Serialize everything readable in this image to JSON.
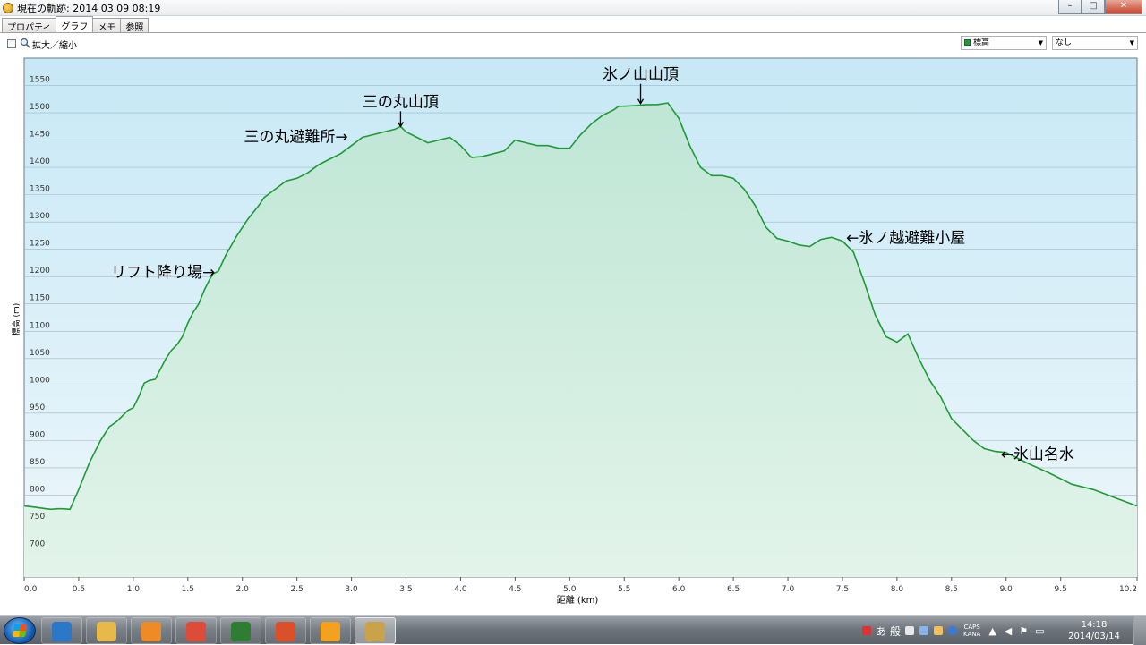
{
  "window": {
    "title": "現在の軌跡: 2014 03 09 08:19",
    "buttons": {
      "minimize": "–",
      "maximize": "□",
      "close": "✕"
    }
  },
  "tabs": [
    {
      "label": "プロパティ",
      "active": false
    },
    {
      "label": "グラフ",
      "active": true
    },
    {
      "label": "メモ",
      "active": false
    },
    {
      "label": "参照",
      "active": false
    }
  ],
  "toolbar": {
    "zoom_label": "拡大／縮小",
    "zoom_checked": false,
    "series_select": "標高",
    "compare_select": "なし"
  },
  "chart_data": {
    "type": "area",
    "xlabel": "距離 (km)",
    "ylabel": "標高 (m)",
    "xlim": [
      0.0,
      10.2
    ],
    "ylim": [
      650,
      1600
    ],
    "xticks": [
      "0.0",
      "0.5",
      "1.0",
      "1.5",
      "2.0",
      "2.5",
      "3.0",
      "3.5",
      "4.0",
      "4.5",
      "5.0",
      "5.5",
      "6.0",
      "6.5",
      "7.0",
      "7.5",
      "8.0",
      "8.5",
      "9.0",
      "9.5",
      "10.2"
    ],
    "yticks": [
      "1550",
      "1500",
      "1450",
      "1400",
      "1350",
      "1300",
      "1250",
      "1200",
      "1150",
      "1100",
      "1050",
      "1000",
      "950",
      "900",
      "850",
      "800",
      "750",
      "700"
    ],
    "grid": true,
    "series": [
      {
        "color": "#1f9a35",
        "x": [
          0.0,
          0.1,
          0.2,
          0.25,
          0.3,
          0.35,
          0.42,
          0.5,
          0.6,
          0.7,
          0.78,
          0.85,
          0.9,
          0.95,
          1.0,
          1.05,
          1.1,
          1.15,
          1.2,
          1.3,
          1.35,
          1.4,
          1.45,
          1.5,
          1.55,
          1.6,
          1.65,
          1.7,
          1.73,
          1.78,
          1.85,
          1.95,
          2.05,
          2.15,
          2.2,
          2.3,
          2.4,
          2.5,
          2.6,
          2.7,
          2.8,
          2.9,
          3.0,
          3.1,
          3.2,
          3.3,
          3.4,
          3.45,
          3.5,
          3.6,
          3.7,
          3.8,
          3.9,
          4.0,
          4.1,
          4.2,
          4.3,
          4.4,
          4.5,
          4.6,
          4.7,
          4.8,
          4.9,
          5.0,
          5.1,
          5.2,
          5.3,
          5.4,
          5.45,
          5.5,
          5.6,
          5.7,
          5.8,
          5.9,
          6.0,
          6.1,
          6.2,
          6.3,
          6.4,
          6.5,
          6.6,
          6.7,
          6.8,
          6.9,
          7.0,
          7.1,
          7.2,
          7.3,
          7.4,
          7.5,
          7.6,
          7.7,
          7.8,
          7.9,
          8.0,
          8.1,
          8.2,
          8.3,
          8.4,
          8.5,
          8.6,
          8.7,
          8.8,
          8.9,
          9.0,
          9.2,
          9.4,
          9.6,
          9.8,
          10.0,
          10.2
        ],
        "y": [
          780,
          778,
          775,
          774,
          775,
          775,
          774,
          810,
          860,
          900,
          925,
          935,
          945,
          955,
          960,
          980,
          1005,
          1010,
          1012,
          1050,
          1065,
          1075,
          1090,
          1115,
          1135,
          1150,
          1175,
          1195,
          1205,
          1210,
          1240,
          1275,
          1305,
          1330,
          1345,
          1360,
          1375,
          1380,
          1390,
          1405,
          1415,
          1425,
          1440,
          1455,
          1460,
          1465,
          1470,
          1475,
          1465,
          1455,
          1445,
          1450,
          1455,
          1440,
          1418,
          1420,
          1425,
          1430,
          1450,
          1445,
          1440,
          1440,
          1435,
          1435,
          1460,
          1480,
          1495,
          1505,
          1512,
          1512,
          1513,
          1515,
          1515,
          1518,
          1490,
          1440,
          1400,
          1385,
          1385,
          1380,
          1360,
          1330,
          1290,
          1270,
          1265,
          1258,
          1255,
          1268,
          1272,
          1265,
          1245,
          1190,
          1130,
          1090,
          1080,
          1095,
          1050,
          1010,
          980,
          940,
          920,
          900,
          885,
          880,
          878,
          858,
          840,
          820,
          810,
          795,
          780
        ]
      }
    ],
    "annotations": [
      {
        "text": "氷ノ山山頂",
        "x": 5.65,
        "y": 1512
      },
      {
        "text": "三の丸山頂",
        "x": 3.45,
        "y": 1470
      },
      {
        "text": "三の丸避難所→",
        "x": 3.05,
        "y": 1452
      },
      {
        "text": "←氷ノ越避難小屋",
        "x": 7.5,
        "y": 1268
      },
      {
        "text": "リフト降り場→",
        "x": 1.75,
        "y": 1205
      },
      {
        "text": "←氷山名水",
        "x": 8.95,
        "y": 872
      }
    ]
  },
  "taskbar": {
    "items": [
      {
        "name": "ie-app",
        "color": "#2b78c8",
        "active": false
      },
      {
        "name": "explorer-app",
        "color": "#e7b84a",
        "active": false
      },
      {
        "name": "media-player-app",
        "color": "#f08a24",
        "active": false
      },
      {
        "name": "chrome-app",
        "color": "#dd4b39",
        "active": false
      },
      {
        "name": "garmin-app",
        "color": "#2e7d32",
        "active": false
      },
      {
        "name": "office-app",
        "color": "#d9502b",
        "active": false
      },
      {
        "name": "outlook-app",
        "color": "#f2a21d",
        "active": false
      },
      {
        "name": "basecamp-app",
        "color": "#caa24a",
        "active": true
      }
    ],
    "ime_mode": "あ",
    "ime_label": "般",
    "caps": "CAPS",
    "kana": "KANA",
    "clock_time": "14:18",
    "clock_date": "2014/03/14"
  }
}
